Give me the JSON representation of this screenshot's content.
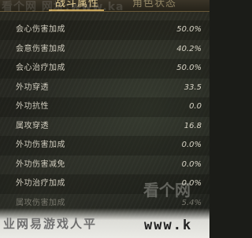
{
  "tabs": {
    "active_label": "战斗属性",
    "inactive_label": "角色状态"
  },
  "watermark": {
    "top": "看个网  网址:www.ka",
    "logo": "看个网",
    "bottom_text": "业网易游戏人平",
    "bottom_url": "www.k"
  },
  "stats": [
    {
      "label": "会心伤害加成",
      "value": "50.0%"
    },
    {
      "label": "会意伤害加成",
      "value": "40.2%"
    },
    {
      "label": "会心治疗加成",
      "value": "50.0%"
    },
    {
      "label": "外功穿透",
      "value": "33.5"
    },
    {
      "label": "外功抗性",
      "value": "0.0"
    },
    {
      "label": "属攻穿透",
      "value": "16.8"
    },
    {
      "label": "外功伤害加成",
      "value": "0.0%"
    },
    {
      "label": "外功伤害减免",
      "value": "0.0%"
    },
    {
      "label": "外功治疗加成",
      "value": "0.0%"
    },
    {
      "label": "属攻伤害加成",
      "value": "5.4%"
    }
  ]
}
